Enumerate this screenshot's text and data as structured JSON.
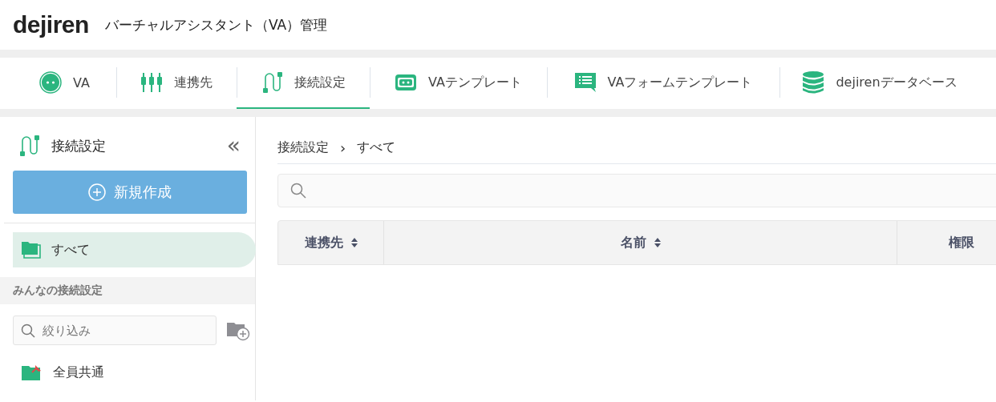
{
  "header": {
    "logo": "dejiren",
    "title": "バーチャルアシスタント（VA）管理"
  },
  "tabs": [
    {
      "label": "VA",
      "selected": false
    },
    {
      "label": "連携先",
      "selected": false
    },
    {
      "label": "接続設定",
      "selected": true
    },
    {
      "label": "VAテンプレート",
      "selected": false
    },
    {
      "label": "VAフォームテンプレート",
      "selected": false
    },
    {
      "label": "dejirenデータベース",
      "selected": false
    }
  ],
  "sidebar": {
    "title": "接続設定",
    "collapse": "«",
    "new_button": "新規作成",
    "items": [
      {
        "label": "すべて",
        "selected": true
      }
    ],
    "section": "みんなの接続設定",
    "filter": {
      "placeholder": "絞り込み"
    },
    "folders": [
      {
        "label": "全員共通",
        "pinned": true
      }
    ]
  },
  "main": {
    "breadcrumb": [
      "接続設定",
      "すべて"
    ],
    "breadcrumb_separator": "›",
    "table": {
      "columns": [
        {
          "label": "連携先",
          "sortable": true
        },
        {
          "label": "名前",
          "sortable": true
        },
        {
          "label": "権限",
          "sortable": false
        }
      ]
    }
  }
}
